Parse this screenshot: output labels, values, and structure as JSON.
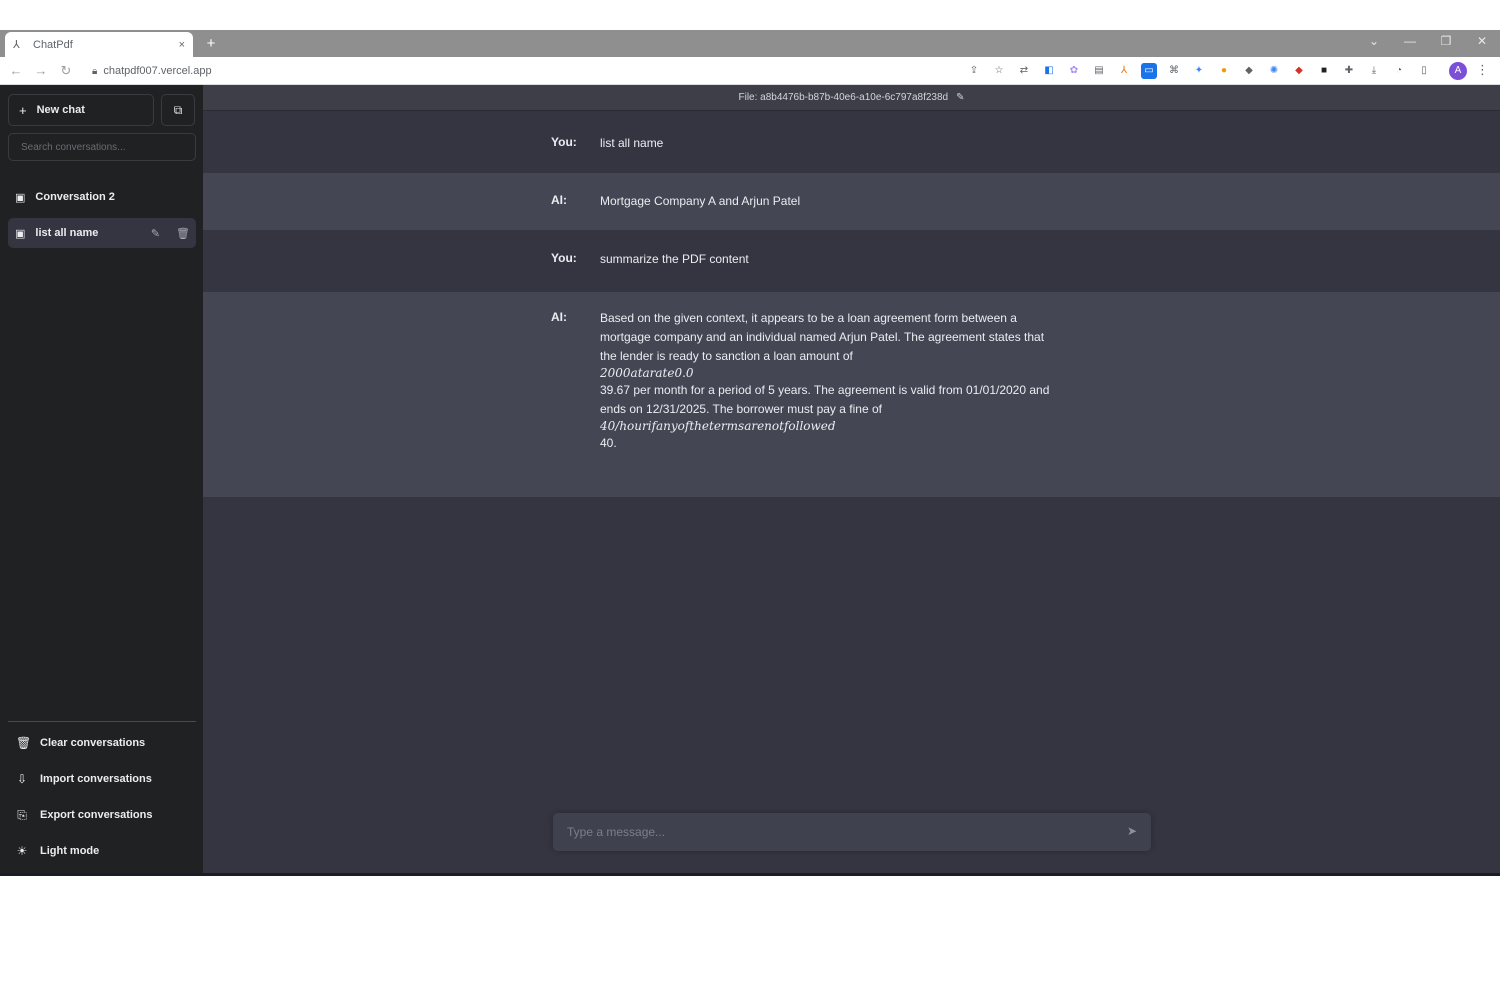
{
  "browser": {
    "tab_title": "ChatPdf",
    "tab_close": "×",
    "new_tab": "+",
    "url": "chatpdf007.vercel.app",
    "window_controls": [
      "⌄",
      "—",
      "❐",
      "✕"
    ],
    "profile_initial": "A"
  },
  "sidebar": {
    "new_chat_label": "New chat",
    "search_placeholder": "Search conversations...",
    "conversations": [
      {
        "label": "Conversation 2",
        "active": false
      },
      {
        "label": "list all name",
        "active": true
      }
    ],
    "footer": [
      {
        "label": "Clear conversations",
        "icon": "trash-icon"
      },
      {
        "label": "Import conversations",
        "icon": "import-icon"
      },
      {
        "label": "Export conversations",
        "icon": "export-icon"
      },
      {
        "label": "Light mode",
        "icon": "sun-icon"
      }
    ]
  },
  "main": {
    "file_label": "File: a8b4476b-b87b-40e6-a10e-6c797a8f238d",
    "messages": [
      {
        "role": "You:",
        "lines": [
          "list all name"
        ]
      },
      {
        "role": "AI:",
        "lines": [
          "Mortgage Company A and Arjun Patel"
        ]
      },
      {
        "role": "You:",
        "lines": [
          "summarize the PDF content"
        ]
      },
      {
        "role": "AI:",
        "lines": [
          "Based on the given context, it appears to be a loan agreement form between a",
          "mortgage company and an individual named Arjun Patel. The agreement states that",
          "the lender is ready to sanction a loan amount of",
          "2000atarate0.0",
          "39.67 per month for a period of 5 years. The agreement is valid from 01/01/2020 and",
          "ends on 12/31/2025. The borrower must pay a fine of",
          "40/hourifanyofthetermsarenotfollowed",
          "40."
        ]
      }
    ],
    "composer_placeholder": "Type a message..."
  }
}
